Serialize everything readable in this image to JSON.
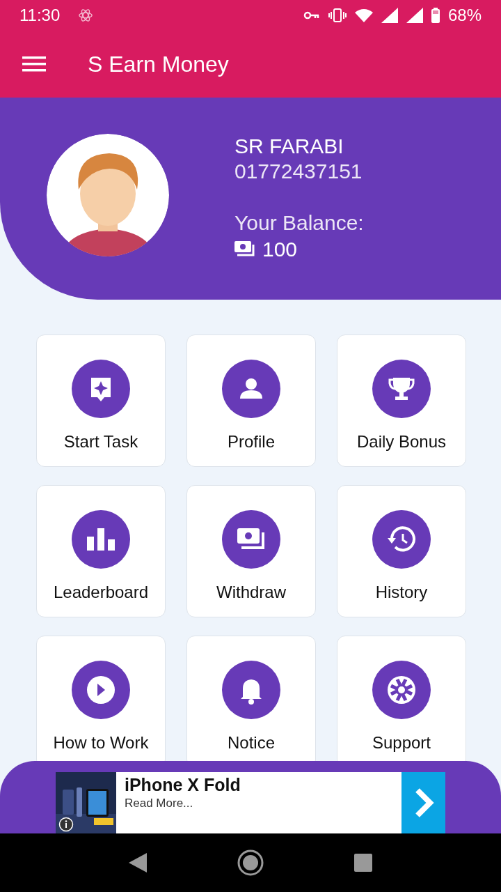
{
  "status_bar": {
    "time": "11:30",
    "battery": "68%"
  },
  "app_bar": {
    "title": "S Earn Money"
  },
  "profile": {
    "name": "SR FARABI",
    "phone": "01772437151",
    "balance_label": "Your Balance:",
    "balance": "100"
  },
  "tiles": [
    {
      "label": "Start Task"
    },
    {
      "label": "Profile"
    },
    {
      "label": "Daily Bonus"
    },
    {
      "label": "Leaderboard"
    },
    {
      "label": "Withdraw"
    },
    {
      "label": "History"
    },
    {
      "label": "How to Work"
    },
    {
      "label": "Notice"
    },
    {
      "label": "Support"
    }
  ],
  "ad": {
    "title": "iPhone X Fold",
    "subtitle": "Read More..."
  }
}
